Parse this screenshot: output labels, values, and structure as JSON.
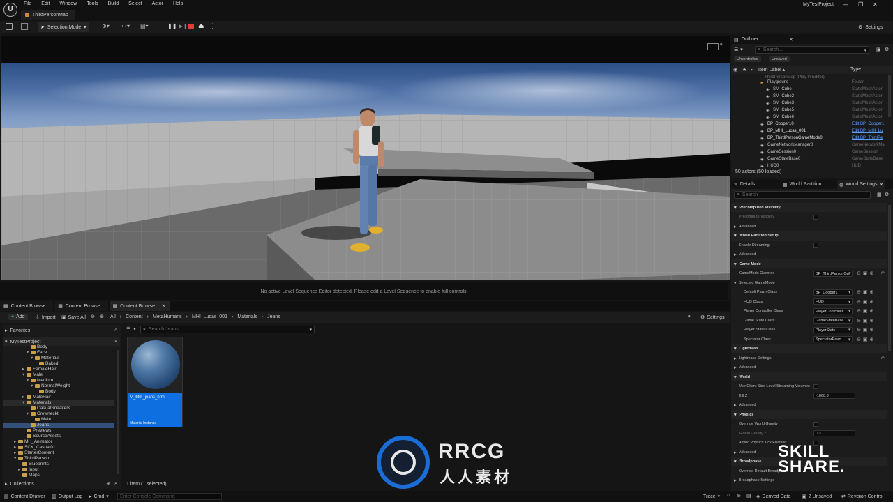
{
  "app": {
    "menu": [
      "File",
      "Edit",
      "Window",
      "Tools",
      "Build",
      "Select",
      "Actor",
      "Help"
    ],
    "map_tab": "ThirdPersonMap",
    "project_name": "MyTestProject",
    "window_controls": [
      "—",
      "❐",
      "✕"
    ]
  },
  "toolbar": {
    "mode": "Selection Mode",
    "settings": "Settings"
  },
  "viewport": {
    "status_message": "No active Level Sequence Editor detected. Please edit a Level Sequence to enable full controls."
  },
  "content_browser": {
    "tabs": [
      "Content Browse...",
      "Content Browse...",
      "Content Browse..."
    ],
    "add": "Add",
    "import": "Import",
    "save_all": "Save All",
    "breadcrumb": [
      "All",
      "Content",
      "MetaHumans",
      "MHI_Lucas_001",
      "Materials",
      "Jeans"
    ],
    "settings": "Settings",
    "favorites": "Favorites",
    "project_root": "MyTestProject",
    "search_placeholder": "Search Jeans",
    "tree": [
      {
        "label": "Body",
        "indent": 34,
        "expand": ""
      },
      {
        "label": "Face",
        "indent": 34,
        "expand": "▾"
      },
      {
        "label": "Materials",
        "indent": 40,
        "expand": "▾"
      },
      {
        "label": "Baked",
        "indent": 46,
        "expand": ""
      },
      {
        "label": "FemaleHair",
        "indent": 28,
        "expand": "▸"
      },
      {
        "label": "Male",
        "indent": 28,
        "expand": "▾"
      },
      {
        "label": "Medium",
        "indent": 34,
        "expand": "▾"
      },
      {
        "label": "NormalWeight",
        "indent": 40,
        "expand": "▾"
      },
      {
        "label": "Body",
        "indent": 46,
        "expand": ""
      },
      {
        "label": "MaleHair",
        "indent": 28,
        "expand": "▸"
      },
      {
        "label": "Materials",
        "indent": 28,
        "expand": "▾"
      },
      {
        "label": "CasualSneakers",
        "indent": 34,
        "expand": ""
      },
      {
        "label": "Crewneckt",
        "indent": 34,
        "expand": "▾"
      },
      {
        "label": "Male",
        "indent": 40,
        "expand": ""
      },
      {
        "label": "Jeans",
        "indent": 34,
        "expand": ""
      },
      {
        "label": "Previews",
        "indent": 28,
        "expand": ""
      },
      {
        "label": "SourceAssets",
        "indent": 28,
        "expand": ""
      },
      {
        "label": "MH_Animator",
        "indent": 16,
        "expand": "▸"
      },
      {
        "label": "SCK_Casual01",
        "indent": 16,
        "expand": "▸"
      },
      {
        "label": "StarterContent",
        "indent": 16,
        "expand": "▸"
      },
      {
        "label": "ThirdPerson",
        "indent": 16,
        "expand": "▾"
      },
      {
        "label": "Blueprints",
        "indent": 22,
        "expand": ""
      },
      {
        "label": "Input",
        "indent": 22,
        "expand": "▸"
      },
      {
        "label": "Maps",
        "indent": 22,
        "expand": ""
      }
    ],
    "collections": "Collections",
    "asset_name": "M_btm_jeans_nrm",
    "asset_type": "Material Instance",
    "selection_status": "1 item (1 selected)"
  },
  "outliner": {
    "title": "Outliner",
    "search_placeholder": "Search...",
    "filter_uncontrolled": "Uncontrolled",
    "filter_unsaved": "Unsaved",
    "col_label": "Item Label ▴",
    "col_type": "Type",
    "map_row": "ThirdPersonMap (Play In Editor)",
    "rows": [
      {
        "label": "Playground",
        "type": "Folder",
        "indent": 52,
        "link": false
      },
      {
        "label": "SM_Cube",
        "type": "StaticMeshActor",
        "indent": 60,
        "link": false
      },
      {
        "label": "SM_Cube2",
        "type": "StaticMeshActor",
        "indent": 60,
        "link": false
      },
      {
        "label": "SM_Cube3",
        "type": "StaticMeshActor",
        "indent": 60,
        "link": false
      },
      {
        "label": "SM_Cube5",
        "type": "StaticMeshActor",
        "indent": 60,
        "link": false
      },
      {
        "label": "SM_Cube6",
        "type": "StaticMeshActor",
        "indent": 60,
        "link": false
      },
      {
        "label": "BP_Cooper10",
        "type": "Edit BP_Cooper1",
        "indent": 52,
        "link": true
      },
      {
        "label": "BP_MHI_Lucas_001",
        "type": "Edit BP_MHI_Lu",
        "indent": 52,
        "link": true
      },
      {
        "label": "BP_ThirdPersonGameMode0",
        "type": "Edit BP_ThirdPe",
        "indent": 52,
        "link": true
      },
      {
        "label": "GameNetworkManager0",
        "type": "GameNetworkMa",
        "indent": 52,
        "link": false
      },
      {
        "label": "GameSession0",
        "type": "GameSession",
        "indent": 52,
        "link": false
      },
      {
        "label": "GameStateBase0",
        "type": "GameStateBase",
        "indent": 52,
        "link": false
      },
      {
        "label": "HUD0",
        "type": "HUD",
        "indent": 52,
        "link": false
      }
    ],
    "actor_count": "50 actors (50 loaded)"
  },
  "details": {
    "tabs": [
      "Details",
      "World Partition",
      "World Settings"
    ],
    "search_placeholder": "Search",
    "rows": [
      {
        "kind": "section",
        "label": "Precomputed Visibility"
      },
      {
        "kind": "check",
        "label": "Precompute Visibility",
        "dim": true
      },
      {
        "kind": "sub",
        "label": "Advanced"
      },
      {
        "kind": "section",
        "label": "World Partition Setup"
      },
      {
        "kind": "check",
        "label": "Enable Streaming"
      },
      {
        "kind": "sub",
        "label": "Advanced"
      },
      {
        "kind": "section",
        "label": "Game Mode"
      },
      {
        "kind": "dropdown",
        "label": "GameMode Override",
        "value": "BP_ThirdPersonGa",
        "reset": true
      },
      {
        "kind": "group",
        "label": "Selected GameMode"
      },
      {
        "kind": "dropdown",
        "label": "Default Pawn Class",
        "value": "BP_Cooper1",
        "indent": true
      },
      {
        "kind": "dropdown",
        "label": "HUD Class",
        "value": "HUD",
        "indent": true
      },
      {
        "kind": "dropdown",
        "label": "Player Controller Class",
        "value": "PlayerController",
        "indent": true
      },
      {
        "kind": "dropdown",
        "label": "Game State Class",
        "value": "GameStateBase",
        "indent": true
      },
      {
        "kind": "dropdown",
        "label": "Player State Class",
        "value": "PlayerState",
        "indent": true
      },
      {
        "kind": "dropdown",
        "label": "Spectator Class",
        "value": "SpectatorPawn",
        "indent": true
      },
      {
        "kind": "section",
        "label": "Lightmass"
      },
      {
        "kind": "sub",
        "label": "Lightmass Settings",
        "reset": true
      },
      {
        "kind": "sub",
        "label": "Advanced"
      },
      {
        "kind": "section",
        "label": "World"
      },
      {
        "kind": "check",
        "label": "Use Client Side Level Streaming Volumes"
      },
      {
        "kind": "number",
        "label": "Kill Z",
        "value": "-1000.0"
      },
      {
        "kind": "sub",
        "label": "Advanced"
      },
      {
        "kind": "section",
        "label": "Physics"
      },
      {
        "kind": "check",
        "label": "Override World Gravity"
      },
      {
        "kind": "number",
        "label": "Global Gravity Z",
        "value": "0.0",
        "dim": true
      },
      {
        "kind": "check",
        "label": "Async Physics Tick Enabled"
      },
      {
        "kind": "sub",
        "label": "Advanced"
      },
      {
        "kind": "section",
        "label": "Broadphase"
      },
      {
        "kind": "check",
        "label": "Override Default Broadphase"
      },
      {
        "kind": "sub",
        "label": "Broadphase Settings"
      }
    ]
  },
  "statusbar": {
    "content_drawer": "Content Drawer",
    "output_log": "Output Log",
    "cmd": "Cmd",
    "console_placeholder": "Enter Console Command",
    "trace": "Trace",
    "derived_data": "Derived Data",
    "unsaved": "2 Unsaved",
    "revision_control": "Revision Control"
  },
  "watermark": {
    "brand": "RRCG",
    "chinese": "人人素材",
    "skillshare_1": "SKILL",
    "skillshare_2": "SHARE."
  }
}
